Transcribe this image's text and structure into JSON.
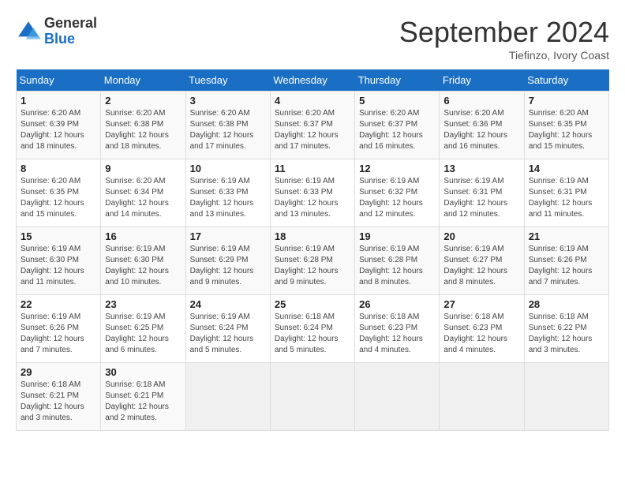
{
  "header": {
    "logo_general": "General",
    "logo_blue": "Blue",
    "month_title": "September 2024",
    "subtitle": "Tiefinzo, Ivory Coast"
  },
  "weekdays": [
    "Sunday",
    "Monday",
    "Tuesday",
    "Wednesday",
    "Thursday",
    "Friday",
    "Saturday"
  ],
  "weeks": [
    [
      {
        "day": "1",
        "info": "Sunrise: 6:20 AM\nSunset: 6:39 PM\nDaylight: 12 hours\nand 18 minutes."
      },
      {
        "day": "2",
        "info": "Sunrise: 6:20 AM\nSunset: 6:38 PM\nDaylight: 12 hours\nand 18 minutes."
      },
      {
        "day": "3",
        "info": "Sunrise: 6:20 AM\nSunset: 6:38 PM\nDaylight: 12 hours\nand 17 minutes."
      },
      {
        "day": "4",
        "info": "Sunrise: 6:20 AM\nSunset: 6:37 PM\nDaylight: 12 hours\nand 17 minutes."
      },
      {
        "day": "5",
        "info": "Sunrise: 6:20 AM\nSunset: 6:37 PM\nDaylight: 12 hours\nand 16 minutes."
      },
      {
        "day": "6",
        "info": "Sunrise: 6:20 AM\nSunset: 6:36 PM\nDaylight: 12 hours\nand 16 minutes."
      },
      {
        "day": "7",
        "info": "Sunrise: 6:20 AM\nSunset: 6:35 PM\nDaylight: 12 hours\nand 15 minutes."
      }
    ],
    [
      {
        "day": "8",
        "info": "Sunrise: 6:20 AM\nSunset: 6:35 PM\nDaylight: 12 hours\nand 15 minutes."
      },
      {
        "day": "9",
        "info": "Sunrise: 6:20 AM\nSunset: 6:34 PM\nDaylight: 12 hours\nand 14 minutes."
      },
      {
        "day": "10",
        "info": "Sunrise: 6:19 AM\nSunset: 6:33 PM\nDaylight: 12 hours\nand 13 minutes."
      },
      {
        "day": "11",
        "info": "Sunrise: 6:19 AM\nSunset: 6:33 PM\nDaylight: 12 hours\nand 13 minutes."
      },
      {
        "day": "12",
        "info": "Sunrise: 6:19 AM\nSunset: 6:32 PM\nDaylight: 12 hours\nand 12 minutes."
      },
      {
        "day": "13",
        "info": "Sunrise: 6:19 AM\nSunset: 6:31 PM\nDaylight: 12 hours\nand 12 minutes."
      },
      {
        "day": "14",
        "info": "Sunrise: 6:19 AM\nSunset: 6:31 PM\nDaylight: 12 hours\nand 11 minutes."
      }
    ],
    [
      {
        "day": "15",
        "info": "Sunrise: 6:19 AM\nSunset: 6:30 PM\nDaylight: 12 hours\nand 11 minutes."
      },
      {
        "day": "16",
        "info": "Sunrise: 6:19 AM\nSunset: 6:30 PM\nDaylight: 12 hours\nand 10 minutes."
      },
      {
        "day": "17",
        "info": "Sunrise: 6:19 AM\nSunset: 6:29 PM\nDaylight: 12 hours\nand 9 minutes."
      },
      {
        "day": "18",
        "info": "Sunrise: 6:19 AM\nSunset: 6:28 PM\nDaylight: 12 hours\nand 9 minutes."
      },
      {
        "day": "19",
        "info": "Sunrise: 6:19 AM\nSunset: 6:28 PM\nDaylight: 12 hours\nand 8 minutes."
      },
      {
        "day": "20",
        "info": "Sunrise: 6:19 AM\nSunset: 6:27 PM\nDaylight: 12 hours\nand 8 minutes."
      },
      {
        "day": "21",
        "info": "Sunrise: 6:19 AM\nSunset: 6:26 PM\nDaylight: 12 hours\nand 7 minutes."
      }
    ],
    [
      {
        "day": "22",
        "info": "Sunrise: 6:19 AM\nSunset: 6:26 PM\nDaylight: 12 hours\nand 7 minutes."
      },
      {
        "day": "23",
        "info": "Sunrise: 6:19 AM\nSunset: 6:25 PM\nDaylight: 12 hours\nand 6 minutes."
      },
      {
        "day": "24",
        "info": "Sunrise: 6:19 AM\nSunset: 6:24 PM\nDaylight: 12 hours\nand 5 minutes."
      },
      {
        "day": "25",
        "info": "Sunrise: 6:18 AM\nSunset: 6:24 PM\nDaylight: 12 hours\nand 5 minutes."
      },
      {
        "day": "26",
        "info": "Sunrise: 6:18 AM\nSunset: 6:23 PM\nDaylight: 12 hours\nand 4 minutes."
      },
      {
        "day": "27",
        "info": "Sunrise: 6:18 AM\nSunset: 6:23 PM\nDaylight: 12 hours\nand 4 minutes."
      },
      {
        "day": "28",
        "info": "Sunrise: 6:18 AM\nSunset: 6:22 PM\nDaylight: 12 hours\nand 3 minutes."
      }
    ],
    [
      {
        "day": "29",
        "info": "Sunrise: 6:18 AM\nSunset: 6:21 PM\nDaylight: 12 hours\nand 3 minutes."
      },
      {
        "day": "30",
        "info": "Sunrise: 6:18 AM\nSunset: 6:21 PM\nDaylight: 12 hours\nand 2 minutes."
      },
      {
        "day": "",
        "info": ""
      },
      {
        "day": "",
        "info": ""
      },
      {
        "day": "",
        "info": ""
      },
      {
        "day": "",
        "info": ""
      },
      {
        "day": "",
        "info": ""
      }
    ]
  ]
}
